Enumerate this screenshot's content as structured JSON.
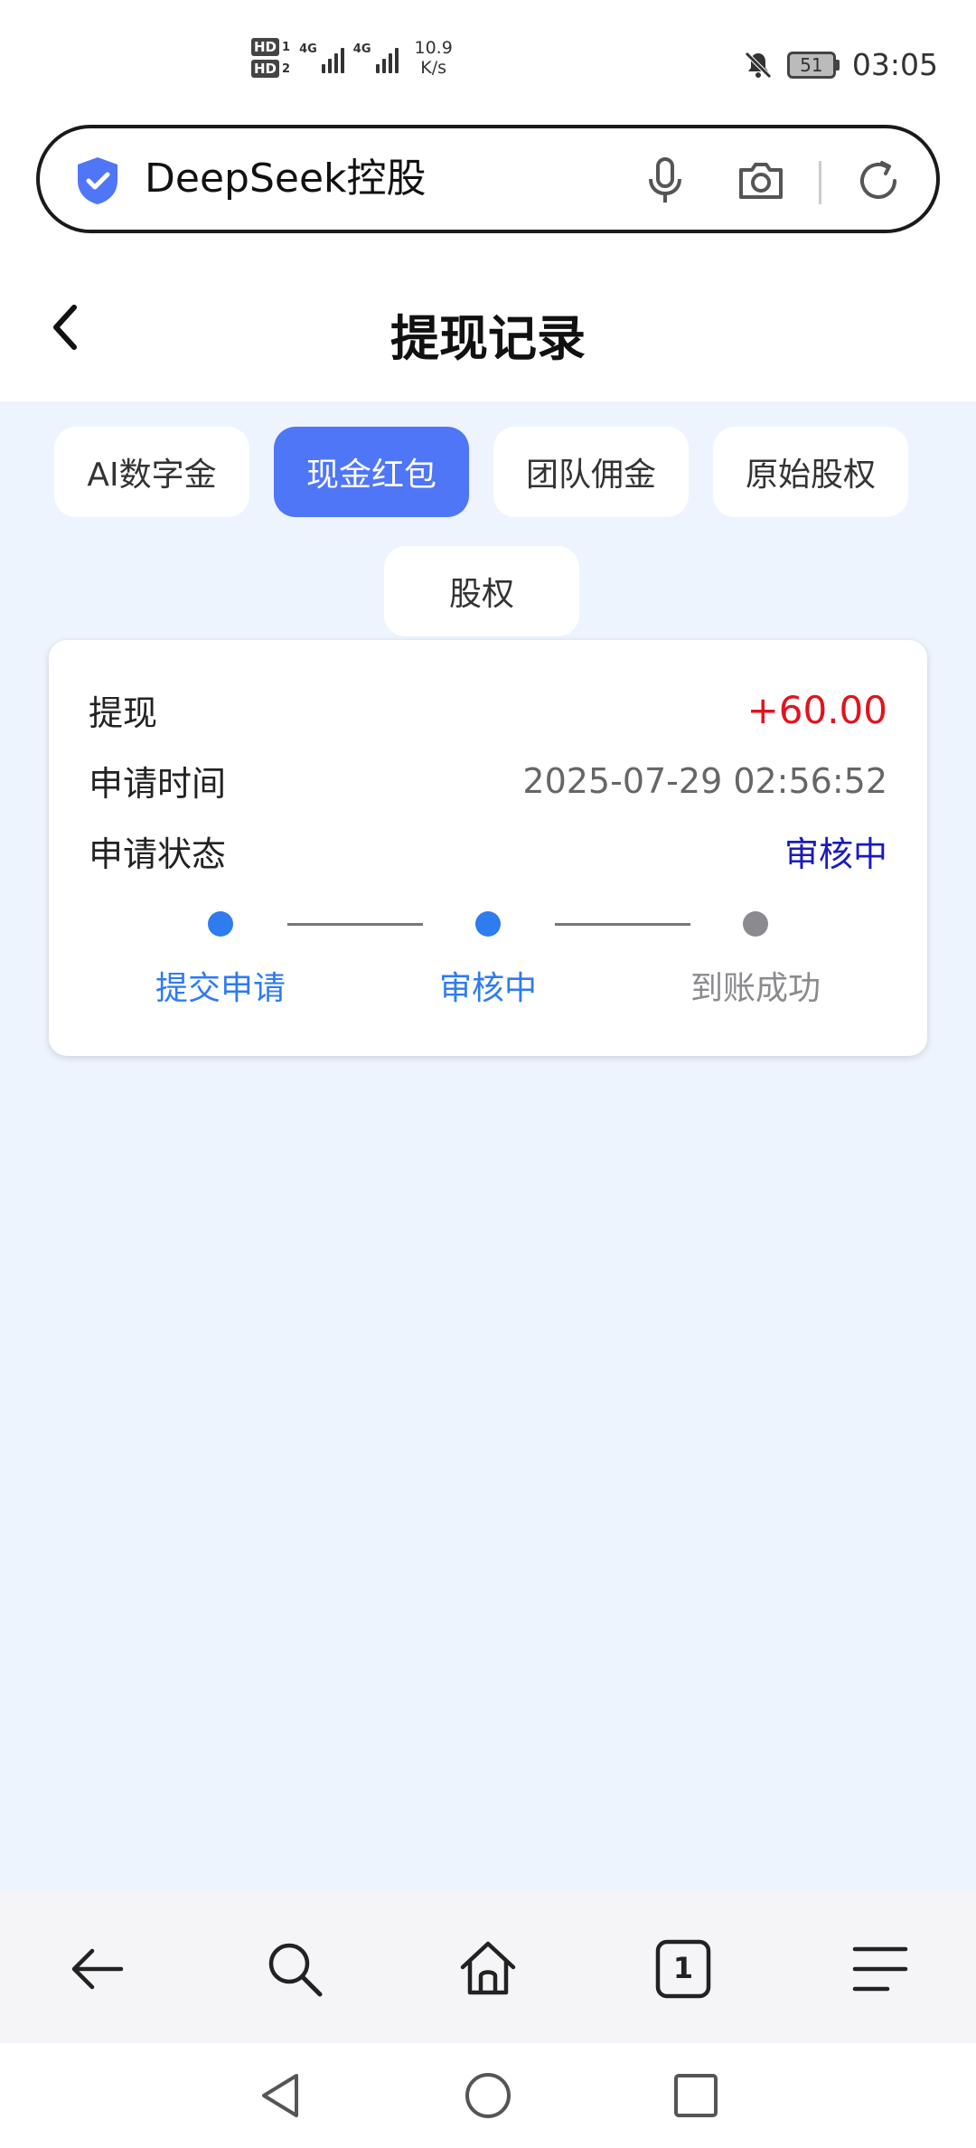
{
  "status_bar": {
    "sim1_label": "HD",
    "sim1_num": "1",
    "sim2_label": "HD",
    "sim2_num": "2",
    "signal1_label": "4G",
    "signal2_label": "4G",
    "net_speed_value": "10.9",
    "net_speed_unit": "K/s",
    "battery_level": "51",
    "time": "03:05",
    "icons": [
      "bell-muted-icon",
      "battery-icon"
    ]
  },
  "address_bar": {
    "text": "DeepSeek控股",
    "icons": [
      "shield-check-icon",
      "microphone-icon",
      "camera-icon",
      "refresh-icon"
    ],
    "shield_color": "#4f76f6"
  },
  "header": {
    "title": "提现记录",
    "back_icon": "chevron-left-icon"
  },
  "tabs": [
    {
      "label": "AI数字金",
      "active": false
    },
    {
      "label": "现金红包",
      "active": true
    },
    {
      "label": "团队佣金",
      "active": false
    },
    {
      "label": "原始股权",
      "active": false
    },
    {
      "label": "股权",
      "active": false
    }
  ],
  "record": {
    "type_label": "提现",
    "amount": "+60.00",
    "time_label": "申请时间",
    "time_value": "2025-07-29 02:56:52",
    "status_label": "申请状态",
    "status_value": "审核中",
    "steps": [
      {
        "label": "提交申请",
        "done": true
      },
      {
        "label": "审核中",
        "done": true
      },
      {
        "label": "到账成功",
        "done": false
      }
    ]
  },
  "bottom_nav": {
    "tab_count": "1",
    "icons": [
      "arrow-left-icon",
      "search-icon",
      "home-icon",
      "tabs-icon",
      "menu-icon"
    ]
  },
  "system_nav": {
    "icons": [
      "back-triangle-icon",
      "home-circle-icon",
      "recents-square-icon"
    ]
  },
  "colors": {
    "accent": "#4f76f6",
    "amount": "#e0141e",
    "status": "#1a1abf",
    "step_active": "#2f7bf0",
    "step_inactive": "#8a8a8f",
    "page_bg": "#eef4fd"
  }
}
